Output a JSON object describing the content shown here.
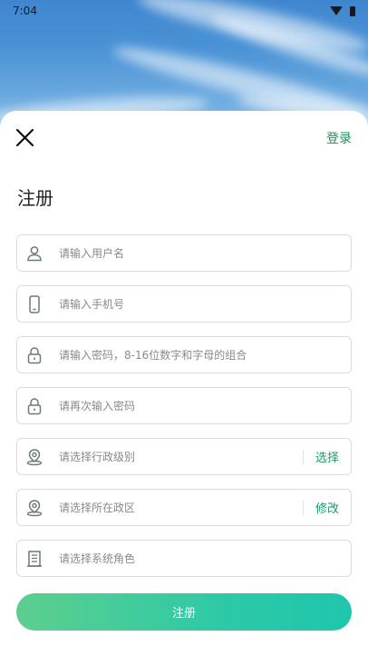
{
  "status_bar": {
    "time": "7:04"
  },
  "header": {
    "login_label": "登录"
  },
  "page": {
    "title": "注册"
  },
  "form": {
    "fields": [
      {
        "placeholder": "请输入用户名",
        "icon": "user-icon"
      },
      {
        "placeholder": "请输入手机号",
        "icon": "phone-icon"
      },
      {
        "placeholder": "请输入密码，8-16位数字和字母的组合",
        "icon": "lock-icon"
      },
      {
        "placeholder": "请再次输入密码",
        "icon": "lock-icon"
      },
      {
        "placeholder": "请选择行政级别",
        "icon": "location-icon",
        "action": "选择"
      },
      {
        "placeholder": "请选择所在政区",
        "icon": "location-icon",
        "action": "修改"
      },
      {
        "placeholder": "请选择系统角色",
        "icon": "building-icon"
      }
    ],
    "submit_label": "注册"
  },
  "colors": {
    "accent": "#1f9a6a",
    "button_start": "#5dcf8e",
    "button_end": "#1fc6ad"
  }
}
